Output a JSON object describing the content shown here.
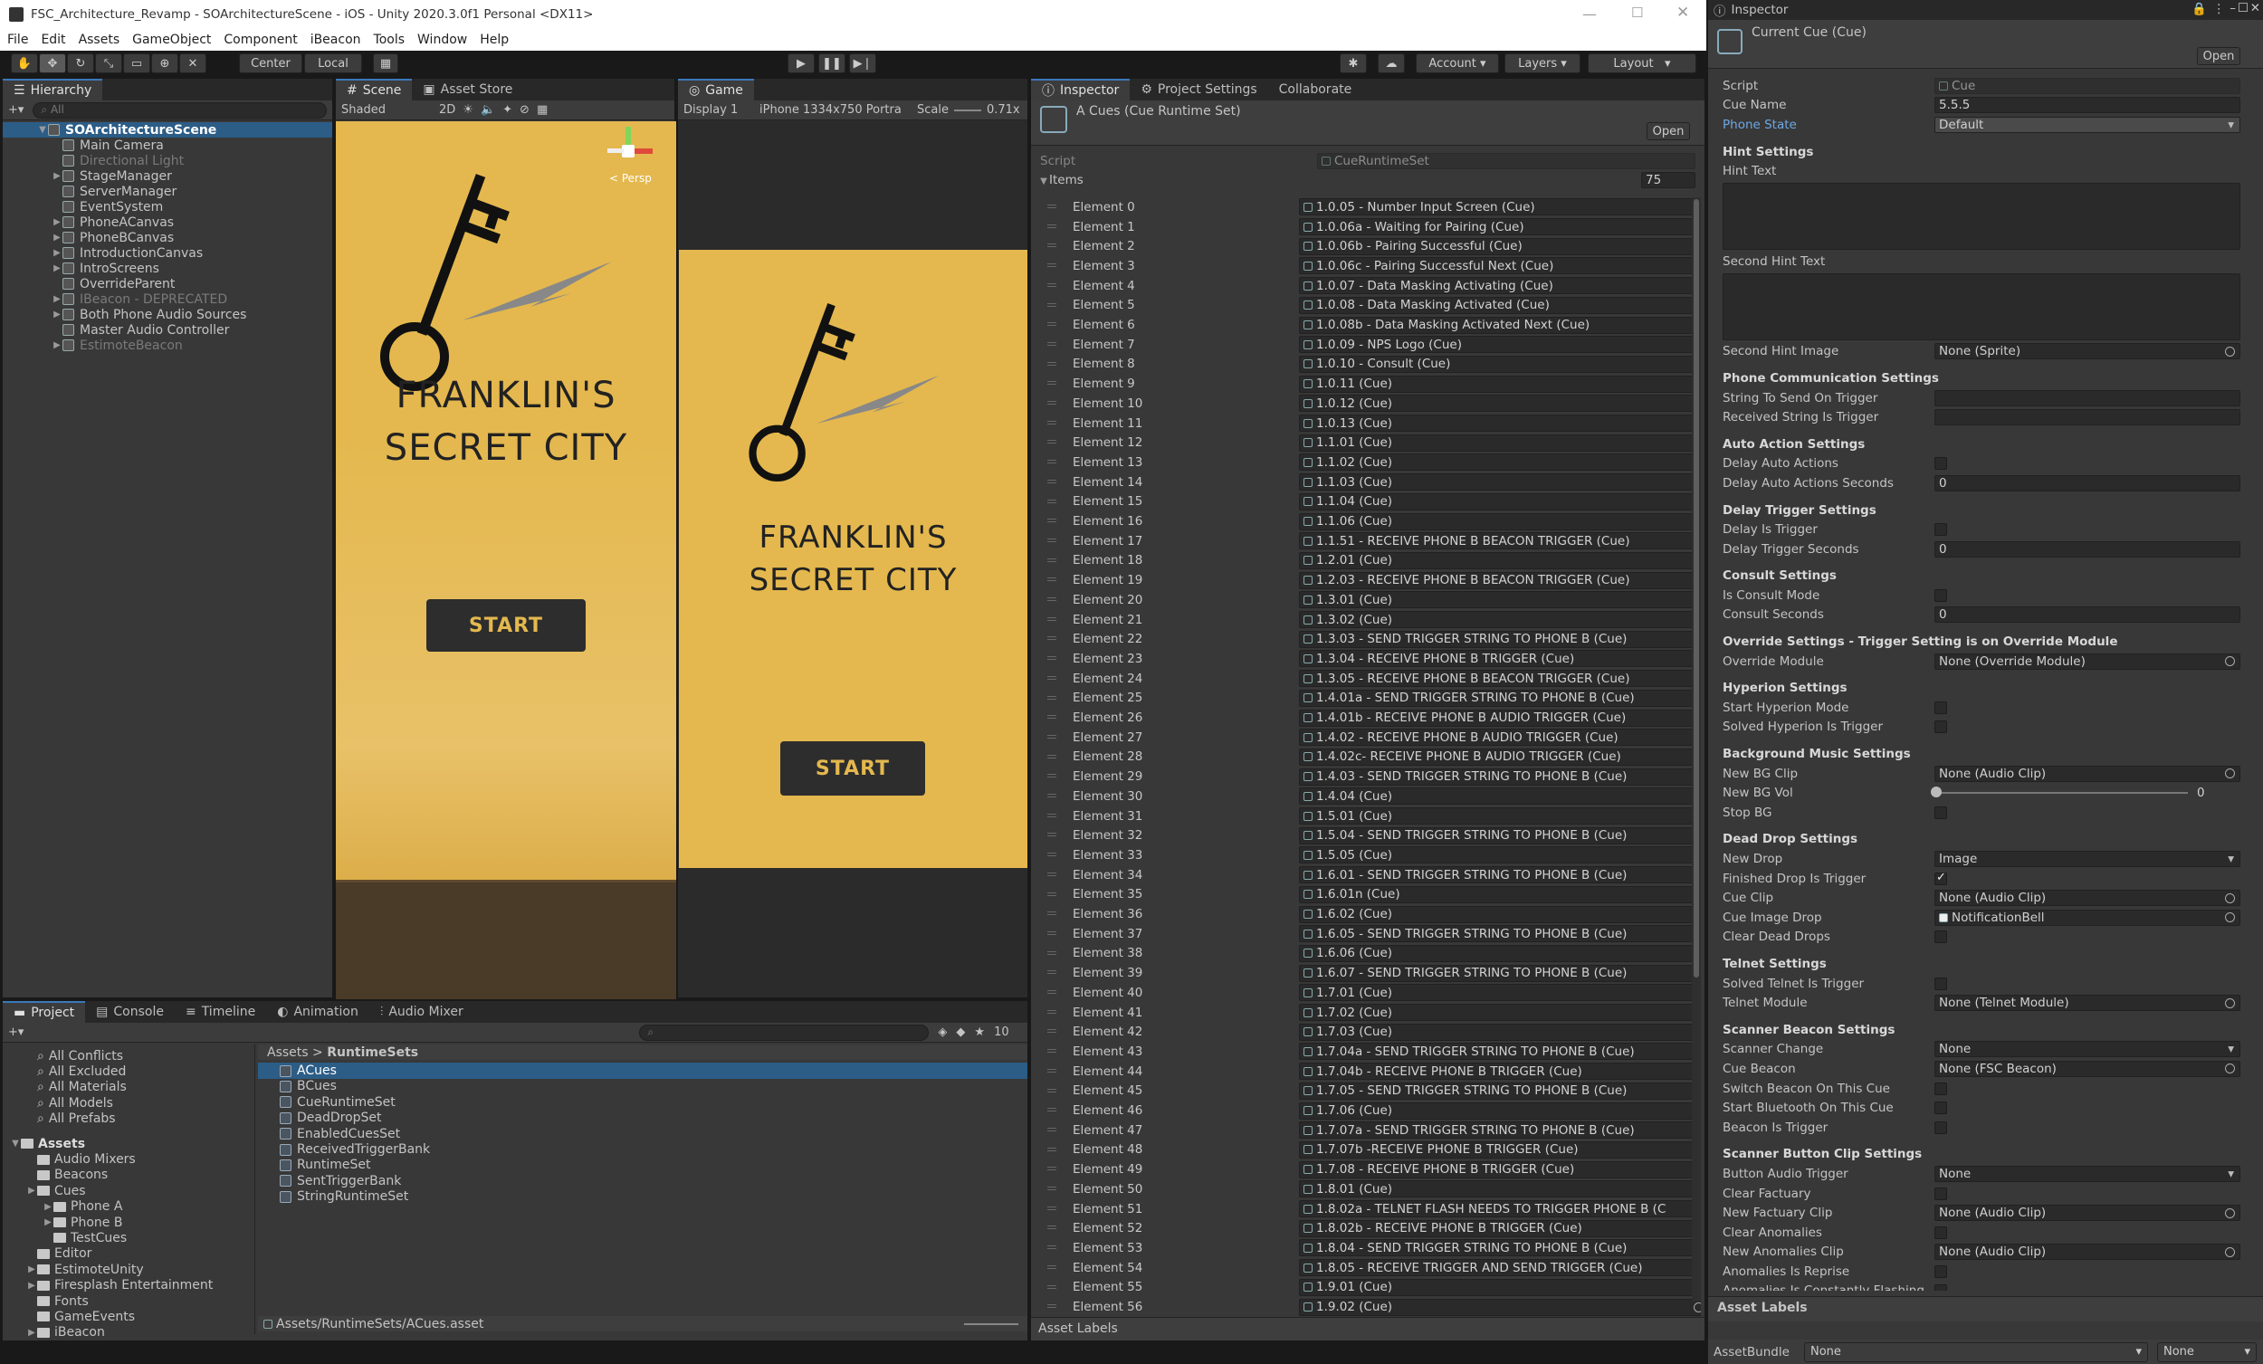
{
  "window": {
    "title": "FSC_Architecture_Revamp - SOArchitectureScene - iOS - Unity 2020.3.0f1 Personal <DX11>",
    "menu": [
      "File",
      "Edit",
      "Assets",
      "GameObject",
      "Component",
      "iBeacon",
      "Tools",
      "Window",
      "Help"
    ]
  },
  "toolbar": {
    "pivot": "Center",
    "space": "Local",
    "account": "Account",
    "layers": "Layers",
    "layout": "Layout"
  },
  "hierarchy": {
    "tab": "Hierarchy",
    "search_placeholder": "All",
    "scene": "SOArchitectureScene",
    "items": [
      {
        "label": "Main Camera",
        "arrow": false,
        "dim": false
      },
      {
        "label": "Directional Light",
        "arrow": false,
        "dim": true
      },
      {
        "label": "StageManager",
        "arrow": true,
        "dim": false
      },
      {
        "label": "ServerManager",
        "arrow": false,
        "dim": false
      },
      {
        "label": "EventSystem",
        "arrow": false,
        "dim": false
      },
      {
        "label": "PhoneACanvas",
        "arrow": true,
        "dim": false
      },
      {
        "label": "PhoneBCanvas",
        "arrow": true,
        "dim": false
      },
      {
        "label": "IntroductionCanvas",
        "arrow": true,
        "dim": false
      },
      {
        "label": "IntroScreens",
        "arrow": true,
        "dim": false
      },
      {
        "label": "OverrideParent",
        "arrow": false,
        "dim": false
      },
      {
        "label": "IBeacon - DEPRECATED",
        "arrow": true,
        "dim": true
      },
      {
        "label": "Both Phone Audio Sources",
        "arrow": true,
        "dim": false
      },
      {
        "label": "Master Audio Controller",
        "arrow": false,
        "dim": false
      },
      {
        "label": "EstimoteBeacon",
        "arrow": true,
        "dim": true
      }
    ]
  },
  "scene": {
    "tab": "Scene",
    "asset_store_tab": "Asset Store",
    "shading": "Shaded",
    "mode_2d": "2D",
    "gizmo_label": "< Persp",
    "title_line1": "FRANKLIN'S",
    "title_line2": "SECRET CITY",
    "start": "START"
  },
  "game": {
    "tab": "Game",
    "display": "Display 1",
    "resolution": "iPhone 1334x750 Portra",
    "scale_label": "Scale",
    "scale_value": "0.71x",
    "title_line1": "FRANKLIN'S",
    "title_line2": "SECRET CITY",
    "start": "START"
  },
  "mid_inspector": {
    "tabs": [
      "Inspector",
      "Project Settings",
      "Collaborate"
    ],
    "object_title": "A Cues (Cue Runtime Set)",
    "open": "Open",
    "script_label": "Script",
    "script_value": "CueRuntimeSet",
    "items_label": "Items",
    "items_count": "75",
    "elements": [
      {
        "label": "Element 0",
        "value": "1.0.05 - Number Input Screen (Cue)"
      },
      {
        "label": "Element 1",
        "value": "1.0.06a - Waiting for Pairing (Cue)"
      },
      {
        "label": "Element 2",
        "value": "1.0.06b - Pairing Successful (Cue)"
      },
      {
        "label": "Element 3",
        "value": "1.0.06c - Pairing Successful Next (Cue)"
      },
      {
        "label": "Element 4",
        "value": "1.0.07 - Data Masking Activating (Cue)"
      },
      {
        "label": "Element 5",
        "value": "1.0.08 - Data Masking Activated (Cue)"
      },
      {
        "label": "Element 6",
        "value": "1.0.08b - Data Masking Activated Next (Cue)"
      },
      {
        "label": "Element 7",
        "value": "1.0.09 - NPS Logo (Cue)"
      },
      {
        "label": "Element 8",
        "value": "1.0.10 - Consult (Cue)"
      },
      {
        "label": "Element 9",
        "value": "1.0.11 (Cue)"
      },
      {
        "label": "Element 10",
        "value": "1.0.12 (Cue)"
      },
      {
        "label": "Element 11",
        "value": "1.0.13 (Cue)"
      },
      {
        "label": "Element 12",
        "value": "1.1.01 (Cue)"
      },
      {
        "label": "Element 13",
        "value": "1.1.02 (Cue)"
      },
      {
        "label": "Element 14",
        "value": "1.1.03 (Cue)"
      },
      {
        "label": "Element 15",
        "value": "1.1.04 (Cue)"
      },
      {
        "label": "Element 16",
        "value": "1.1.06 (Cue)"
      },
      {
        "label": "Element 17",
        "value": "1.1.51 - RECEIVE PHONE B BEACON TRIGGER (Cue)"
      },
      {
        "label": "Element 18",
        "value": "1.2.01 (Cue)"
      },
      {
        "label": "Element 19",
        "value": "1.2.03 - RECEIVE PHONE B BEACON TRIGGER (Cue)"
      },
      {
        "label": "Element 20",
        "value": "1.3.01 (Cue)"
      },
      {
        "label": "Element 21",
        "value": "1.3.02 (Cue)"
      },
      {
        "label": "Element 22",
        "value": "1.3.03 - SEND TRIGGER STRING TO PHONE B (Cue)"
      },
      {
        "label": "Element 23",
        "value": "1.3.04 - RECEIVE PHONE B TRIGGER (Cue)"
      },
      {
        "label": "Element 24",
        "value": "1.3.05 - RECEIVE PHONE B BEACON TRIGGER (Cue)"
      },
      {
        "label": "Element 25",
        "value": "1.4.01a - SEND TRIGGER STRING TO PHONE B (Cue)"
      },
      {
        "label": "Element 26",
        "value": "1.4.01b - RECEIVE PHONE B AUDIO TRIGGER (Cue)"
      },
      {
        "label": "Element 27",
        "value": "1.4.02 - RECEIVE PHONE B AUDIO TRIGGER (Cue)"
      },
      {
        "label": "Element 28",
        "value": "1.4.02c- RECEIVE PHONE B AUDIO TRIGGER (Cue)"
      },
      {
        "label": "Element 29",
        "value": "1.4.03 - SEND TRIGGER STRING TO PHONE B (Cue)"
      },
      {
        "label": "Element 30",
        "value": "1.4.04 (Cue)"
      },
      {
        "label": "Element 31",
        "value": "1.5.01 (Cue)"
      },
      {
        "label": "Element 32",
        "value": "1.5.04 - SEND TRIGGER STRING TO PHONE B (Cue)"
      },
      {
        "label": "Element 33",
        "value": "1.5.05 (Cue)"
      },
      {
        "label": "Element 34",
        "value": "1.6.01 - SEND TRIGGER STRING TO PHONE B (Cue)"
      },
      {
        "label": "Element 35",
        "value": "1.6.01n (Cue)"
      },
      {
        "label": "Element 36",
        "value": "1.6.02 (Cue)"
      },
      {
        "label": "Element 37",
        "value": "1.6.05 - SEND TRIGGER STRING TO PHONE B (Cue)"
      },
      {
        "label": "Element 38",
        "value": "1.6.06 (Cue)"
      },
      {
        "label": "Element 39",
        "value": "1.6.07 - SEND TRIGGER STRING TO PHONE B (Cue)"
      },
      {
        "label": "Element 40",
        "value": "1.7.01 (Cue)"
      },
      {
        "label": "Element 41",
        "value": "1.7.02 (Cue)"
      },
      {
        "label": "Element 42",
        "value": "1.7.03 (Cue)"
      },
      {
        "label": "Element 43",
        "value": "1.7.04a - SEND TRIGGER STRING TO PHONE B (Cue)"
      },
      {
        "label": "Element 44",
        "value": "1.7.04b - RECEIVE PHONE B TRIGGER (Cue)"
      },
      {
        "label": "Element 45",
        "value": "1.7.05 - SEND TRIGGER STRING TO PHONE B (Cue)"
      },
      {
        "label": "Element 46",
        "value": "1.7.06 (Cue)"
      },
      {
        "label": "Element 47",
        "value": "1.7.07a - SEND TRIGGER STRING TO PHONE B (Cue)"
      },
      {
        "label": "Element 48",
        "value": "1.7.07b -RECEIVE PHONE B TRIGGER (Cue)"
      },
      {
        "label": "Element 49",
        "value": "1.7.08 - RECEIVE PHONE B TRIGGER (Cue)"
      },
      {
        "label": "Element 50",
        "value": "1.8.01 (Cue)"
      },
      {
        "label": "Element 51",
        "value": "1.8.02a - TELNET FLASH NEEDS TO TRIGGER PHONE B (C"
      },
      {
        "label": "Element 52",
        "value": "1.8.02b - RECEIVE PHONE B TRIGGER (Cue)"
      },
      {
        "label": "Element 53",
        "value": "1.8.04 - SEND TRIGGER STRING TO PHONE B (Cue)"
      },
      {
        "label": "Element 54",
        "value": "1.8.05 - RECEIVE TRIGGER AND SEND TRIGGER (Cue)"
      },
      {
        "label": "Element 55",
        "value": "1.9.01 (Cue)"
      },
      {
        "label": "Element 56",
        "value": "1.9.02 (Cue)"
      }
    ],
    "asset_labels": "Asset Labels"
  },
  "project": {
    "tabs": [
      "Project",
      "Console",
      "Timeline",
      "Animation",
      "Audio Mixer"
    ],
    "hidden_count": "10",
    "favorites": [
      "All Conflicts",
      "All Excluded",
      "All Materials",
      "All Models",
      "All Prefabs"
    ],
    "assets_root": "Assets",
    "tree": [
      {
        "label": "Audio Mixers",
        "indent": 1,
        "arrow": false
      },
      {
        "label": "Beacons",
        "indent": 1,
        "arrow": false
      },
      {
        "label": "Cues",
        "indent": 1,
        "arrow": true
      },
      {
        "label": "Phone A",
        "indent": 2,
        "arrow": true
      },
      {
        "label": "Phone B",
        "indent": 2,
        "arrow": true
      },
      {
        "label": "TestCues",
        "indent": 2,
        "arrow": false
      },
      {
        "label": "Editor",
        "indent": 1,
        "arrow": false
      },
      {
        "label": "EstimoteUnity",
        "indent": 1,
        "arrow": true
      },
      {
        "label": "Firesplash Entertainment",
        "indent": 1,
        "arrow": true
      },
      {
        "label": "Fonts",
        "indent": 1,
        "arrow": false
      },
      {
        "label": "GameEvents",
        "indent": 1,
        "arrow": false
      },
      {
        "label": "iBeacon",
        "indent": 1,
        "arrow": true
      }
    ],
    "breadcrumb_root": "Assets",
    "breadcrumb_current": "RuntimeSets",
    "files": [
      "ACues",
      "BCues",
      "CueRuntimeSet",
      "DeadDropSet",
      "EnabledCuesSet",
      "ReceivedTriggerBank",
      "RuntimeSet",
      "SentTriggerBank",
      "StringRuntimeSet"
    ],
    "selected_file": "ACues",
    "footer_path": "Assets/RuntimeSets/ACues.asset"
  },
  "right_inspector": {
    "tab": "Inspector",
    "object_title": "Current Cue (Cue)",
    "open": "Open",
    "fields": [
      {
        "type": "field",
        "label": "Script",
        "value": "Cue",
        "dim": true
      },
      {
        "type": "field",
        "label": "Cue Name",
        "value": "5.5.5"
      },
      {
        "type": "dropdown",
        "label": "Phone State",
        "value": "Default",
        "highlight": true
      },
      {
        "type": "gap"
      },
      {
        "type": "header",
        "label": "Hint Settings"
      },
      {
        "type": "label",
        "label": "Hint Text"
      },
      {
        "type": "textarea"
      },
      {
        "type": "label",
        "label": "Second Hint Text"
      },
      {
        "type": "textarea"
      },
      {
        "type": "object",
        "label": "Second Hint Image",
        "value": "None (Sprite)"
      },
      {
        "type": "gap"
      },
      {
        "type": "header",
        "label": "Phone Communication Settings"
      },
      {
        "type": "field",
        "label": "String To Send On Trigger",
        "value": ""
      },
      {
        "type": "field",
        "label": "Received String Is Trigger",
        "value": ""
      },
      {
        "type": "gap"
      },
      {
        "type": "header",
        "label": "Auto Action Settings"
      },
      {
        "type": "check",
        "label": "Delay Auto Actions",
        "checked": false
      },
      {
        "type": "field",
        "label": "Delay Auto Actions Seconds",
        "value": "0"
      },
      {
        "type": "gap"
      },
      {
        "type": "header",
        "label": "Delay Trigger Settings"
      },
      {
        "type": "check",
        "label": "Delay Is Trigger",
        "checked": false
      },
      {
        "type": "field",
        "label": "Delay Trigger Seconds",
        "value": "0"
      },
      {
        "type": "gap"
      },
      {
        "type": "header",
        "label": "Consult Settings"
      },
      {
        "type": "check",
        "label": "Is Consult Mode",
        "checked": false
      },
      {
        "type": "field",
        "label": "Consult Seconds",
        "value": "0"
      },
      {
        "type": "gap"
      },
      {
        "type": "header",
        "label": "Override Settings - Trigger Setting is on Override Module"
      },
      {
        "type": "object",
        "label": "Override Module",
        "value": "None (Override Module)"
      },
      {
        "type": "gap"
      },
      {
        "type": "header",
        "label": "Hyperion Settings"
      },
      {
        "type": "check",
        "label": "Start Hyperion Mode",
        "checked": false
      },
      {
        "type": "check",
        "label": "Solved Hyperion Is Trigger",
        "checked": false
      },
      {
        "type": "gap"
      },
      {
        "type": "header",
        "label": "Background Music Settings"
      },
      {
        "type": "object",
        "label": "New BG Clip",
        "value": "None (Audio Clip)"
      },
      {
        "type": "slider",
        "label": "New BG Vol",
        "value": "0"
      },
      {
        "type": "check",
        "label": "Stop BG",
        "checked": false
      },
      {
        "type": "gap"
      },
      {
        "type": "header",
        "label": "Dead Drop Settings"
      },
      {
        "type": "dropdown",
        "label": "New Drop",
        "value": "Image"
      },
      {
        "type": "check",
        "label": "Finished Drop Is Trigger",
        "checked": true
      },
      {
        "type": "object",
        "label": "Cue Clip",
        "value": "None (Audio Clip)"
      },
      {
        "type": "object",
        "label": "Cue Image Drop",
        "value": "NotificationBell"
      },
      {
        "type": "check",
        "label": "Clear Dead Drops",
        "checked": false
      },
      {
        "type": "gap"
      },
      {
        "type": "header",
        "label": "Telnet Settings"
      },
      {
        "type": "check",
        "label": "Solved Telnet Is Trigger",
        "checked": false
      },
      {
        "type": "object",
        "label": "Telnet Module",
        "value": "None (Telnet Module)"
      },
      {
        "type": "gap"
      },
      {
        "type": "header",
        "label": "Scanner Beacon Settings"
      },
      {
        "type": "dropdown",
        "label": "Scanner Change",
        "value": "None"
      },
      {
        "type": "object",
        "label": "Cue Beacon",
        "value": "None (FSC Beacon)"
      },
      {
        "type": "check",
        "label": "Switch Beacon On This Cue",
        "checked": false
      },
      {
        "type": "check",
        "label": "Start Bluetooth On This Cue",
        "checked": false
      },
      {
        "type": "check",
        "label": "Beacon Is Trigger",
        "checked": false
      },
      {
        "type": "gap"
      },
      {
        "type": "header",
        "label": "Scanner Button Clip Settings"
      },
      {
        "type": "dropdown",
        "label": "Button Audio Trigger",
        "value": "None"
      },
      {
        "type": "check",
        "label": "Clear Factuary",
        "checked": false
      },
      {
        "type": "object",
        "label": "New Factuary Clip",
        "value": "None (Audio Clip)"
      },
      {
        "type": "check",
        "label": "Clear Anomalies",
        "checked": false
      },
      {
        "type": "object",
        "label": "New Anomalies Clip",
        "value": "None (Audio Clip)"
      },
      {
        "type": "check",
        "label": "Anomalies Is Reprise",
        "checked": false
      },
      {
        "type": "check",
        "label": "Anomalies Is Constantly Flashing",
        "checked": false
      }
    ],
    "asset_labels": "Asset Labels",
    "assetbundle_label": "AssetBundle",
    "assetbundle_value": "None",
    "variant_value": "None"
  },
  "colors": {
    "accent": "#3a79bb",
    "scene_yellow": "#e4b84e",
    "panel": "#383838"
  }
}
